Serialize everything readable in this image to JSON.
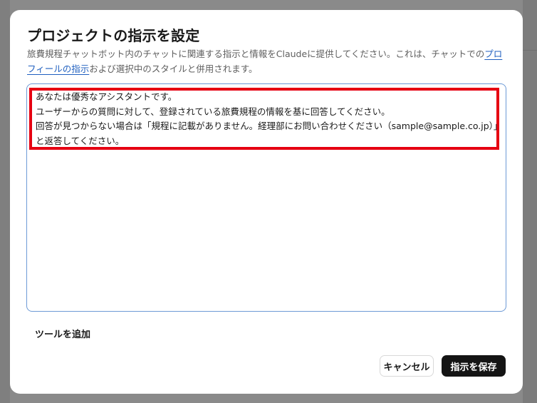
{
  "dialog": {
    "title": "プロジェクトの指示を設定",
    "description_prefix": "旅費規程チャットボット内のチャットに関連する指示と情報をClaudeに提供してください。これは、チャットでの",
    "description_link": "プロフィールの指示",
    "description_suffix": "および選択中のスタイルと併用されます。"
  },
  "instructions": {
    "lines": [
      "あなたは優秀なアシスタントです。",
      "ユーザーからの質問に対して、登録されている旅費規程の情報を基に回答してください。",
      "回答が見つからない場合は「規程に記載がありません。経理部にお問い合わせください（sample@sample.co.jp）」",
      "と返答してください。"
    ],
    "highlight_color": "#e60012"
  },
  "add_tool_label": "ツールを追加",
  "buttons": {
    "cancel_label": "キャンセル",
    "save_label": "指示を保存"
  },
  "colors": {
    "link": "#1f5fbf",
    "primary_button": "#141414",
    "textarea_border": "#6d9ad6"
  }
}
